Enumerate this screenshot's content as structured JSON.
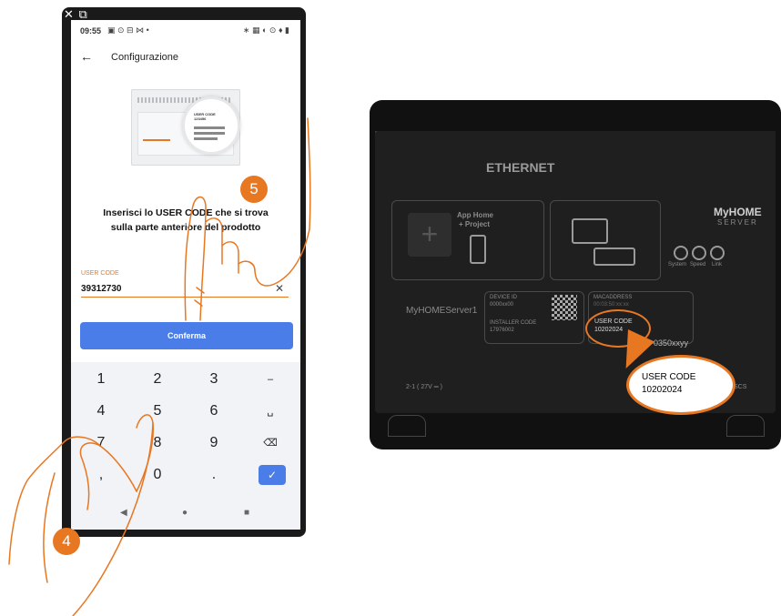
{
  "phone": {
    "top_icons": "✕ ⧉",
    "status": {
      "time": "09:55",
      "left_icons": "▣ ⊙ ⊟ ⋈ •",
      "right_icons": "∗ ▦ ◐ ⊙ ♦ ▮"
    },
    "appbar": {
      "back_glyph": "←",
      "title": "Configurazione"
    },
    "device_image": {
      "label_line1": "USER CODE",
      "label_line2": "123456"
    },
    "instruction_line1": "Inserisci lo USER CODE che si trova",
    "instruction_line2": "sulla parte anteriore del prodotto",
    "field": {
      "label": "USER CODE",
      "value": "39312730",
      "clear_glyph": "✕"
    },
    "confirm_label": "Conferma",
    "keypad": {
      "row1": [
        "1",
        "2",
        "3",
        "–"
      ],
      "row2": [
        "4",
        "5",
        "6",
        "␣"
      ],
      "row3": [
        "7",
        "8",
        "9",
        "⌫"
      ],
      "row4": [
        ",",
        "0",
        ".",
        "✓"
      ]
    },
    "navbar": {
      "back": "◀",
      "home": "●",
      "recents": "■"
    }
  },
  "steps": {
    "step_4": "4",
    "step_5": "5"
  },
  "device": {
    "ethernet_label": "ETHERNET",
    "app_label_line1": "App Home",
    "app_label_line2": "+ Project",
    "brand": "MyHOME",
    "brand_sub": "SERVER",
    "led_labels": [
      "System",
      "Speed",
      "Link"
    ],
    "model": "MyHOMEServer1",
    "device_id_label": "DEVICE ID",
    "device_id_value": "0000xx00",
    "installer_code_label": "INSTALLER CODE",
    "installer_code_value": "17976002",
    "mac_label": "MACADDRESS",
    "mac_value": "00:03:50:xx:xx",
    "user_code_label": "USER CODE",
    "user_code_value": "10202024",
    "terminal_left": "2-1 ( 27V ═ )",
    "terminal_right": "SCS",
    "partial_mac": "0350xxyy"
  },
  "callout": {
    "line1": "USER CODE",
    "line2": "10202024"
  },
  "colors": {
    "accent": "#e87722",
    "button": "#4a7de8",
    "device": "#1f1f1f"
  }
}
